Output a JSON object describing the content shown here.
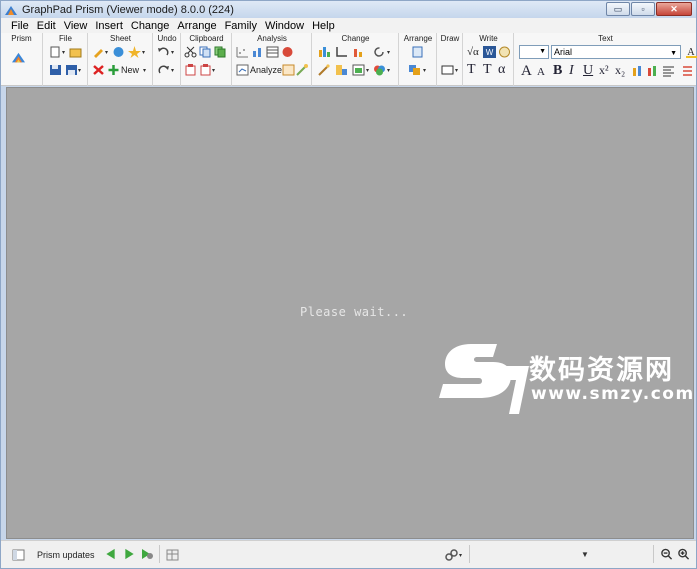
{
  "window": {
    "title": "GraphPad Prism (Viewer mode) 8.0.0 (224)",
    "controls": {
      "minimize": "▭",
      "maximize": "▫",
      "close": "✕"
    }
  },
  "menu": [
    "File",
    "Edit",
    "View",
    "Insert",
    "Change",
    "Arrange",
    "Family",
    "Window",
    "Help"
  ],
  "toolbar": {
    "groups": [
      "Prism",
      "File",
      "Sheet",
      "Undo",
      "Clipboard",
      "Analysis",
      "Change",
      "Arrange",
      "Draw",
      "Write",
      "Text"
    ],
    "new_label": "New",
    "analyze_label": "Analyze",
    "font_size_value": "",
    "font_name": "Arial",
    "format_buttons": {
      "grow": "A",
      "shrink": "A",
      "bold": "B",
      "italic": "I",
      "underline": "U",
      "superscript": "x²",
      "subscript": "x₂"
    },
    "write": {
      "sqrt": "√α",
      "text_t": "T",
      "text_t2": "T",
      "alpha": "α"
    }
  },
  "content": {
    "message": "Please wait...",
    "watermark_cn": "数码资源网",
    "watermark_url": "www.smzy.com"
  },
  "statusbar": {
    "updates_label": "Prism updates"
  },
  "colors": {
    "content_bg": "#a6a6a6",
    "toolbar_bg": "#f7f7f7",
    "nav_green": "#3fa83f"
  }
}
